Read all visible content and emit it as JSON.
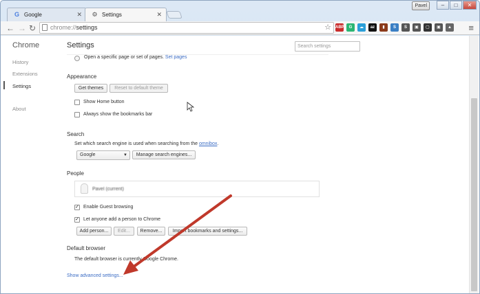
{
  "tabs": [
    {
      "title": "Google",
      "icon": "G"
    },
    {
      "title": "Settings",
      "icon": "⚙"
    }
  ],
  "window": {
    "user": "Pavel"
  },
  "toolbar": {
    "url_scheme": "chrome://",
    "url_path": "settings"
  },
  "extensions": [
    {
      "label": "ABP",
      "color": "#c92b2b"
    },
    {
      "label": "G",
      "color": "#2bb673"
    },
    {
      "label": "☁",
      "color": "#2b9fd8"
    },
    {
      "label": "az",
      "color": "#111111"
    },
    {
      "label": "▮",
      "color": "#8b3a1a"
    },
    {
      "label": "S",
      "color": "#3b7fc4"
    },
    {
      "label": "S",
      "color": "#555555"
    },
    {
      "label": "▣",
      "color": "#555555"
    },
    {
      "label": "▢",
      "color": "#333333"
    },
    {
      "label": "▣",
      "color": "#555555"
    },
    {
      "label": "▲",
      "color": "#666666"
    }
  ],
  "sidebar": {
    "title": "Chrome",
    "items": [
      "History",
      "Extensions",
      "Settings",
      "About"
    ]
  },
  "page": {
    "title": "Settings",
    "search_placeholder": "Search settings"
  },
  "startup": {
    "option": "Open a specific page or set of pages.",
    "link": "Set pages"
  },
  "appearance": {
    "heading": "Appearance",
    "get_themes": "Get themes",
    "reset_theme": "Reset to default theme",
    "show_home": "Show Home button",
    "show_bookmarks": "Always show the bookmarks bar"
  },
  "search": {
    "heading": "Search",
    "desc": "Set which search engine is used when searching from the",
    "desc_link": "omnibox",
    "desc_end": ".",
    "engine": "Google",
    "manage": "Manage search engines..."
  },
  "people": {
    "heading": "People",
    "current_user": "Pavel (current)",
    "guest": "Enable Guest browsing",
    "anyone_add": "Let anyone add a person to Chrome",
    "add": "Add person...",
    "edit": "Edit...",
    "remove": "Remove...",
    "import": "Import bookmarks and settings..."
  },
  "default_browser": {
    "heading": "Default browser",
    "desc": "The default browser is currently Google Chrome."
  },
  "advanced_link": "Show advanced settings...",
  "colors": {
    "link": "#3b6cc4",
    "annotation_arrow": "#c0392b"
  }
}
